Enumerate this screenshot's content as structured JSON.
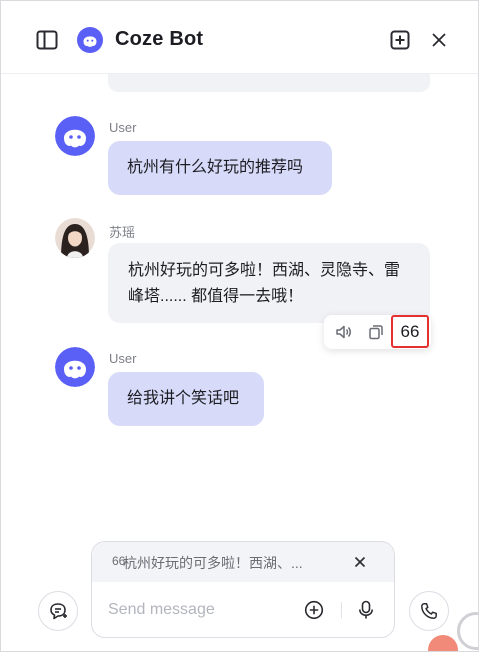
{
  "header": {
    "title": "Coze Bot",
    "icons": {
      "sidebar_toggle": "sidebar-toggle-icon",
      "bot_avatar": "bot-avatar-icon",
      "new_chat": "new-chat-icon",
      "close": "close-icon"
    }
  },
  "messages": [
    {
      "role": "user",
      "sender": "User",
      "text": "杭州有什么好玩的推荐吗"
    },
    {
      "role": "bot",
      "sender": "苏瑶",
      "text": "杭州好玩的可多啦！西湖、灵隐寺、雷峰塔...... 都值得一去哦！"
    },
    {
      "role": "user",
      "sender": "User",
      "text": "给我讲个笑话吧"
    }
  ],
  "actions": {
    "read_aloud_icon": "speaker-icon",
    "copy_icon": "copy-icon",
    "quote_label": "66"
  },
  "composer": {
    "quote_mark": "66",
    "quote_text": "杭州好玩的可多啦！西湖、...",
    "placeholder": "Send message"
  },
  "colors": {
    "accent": "#5a5ff6",
    "user_bubble": "#d8daf9",
    "bot_bubble": "#f1f2f6",
    "highlight": "#e4302e"
  }
}
